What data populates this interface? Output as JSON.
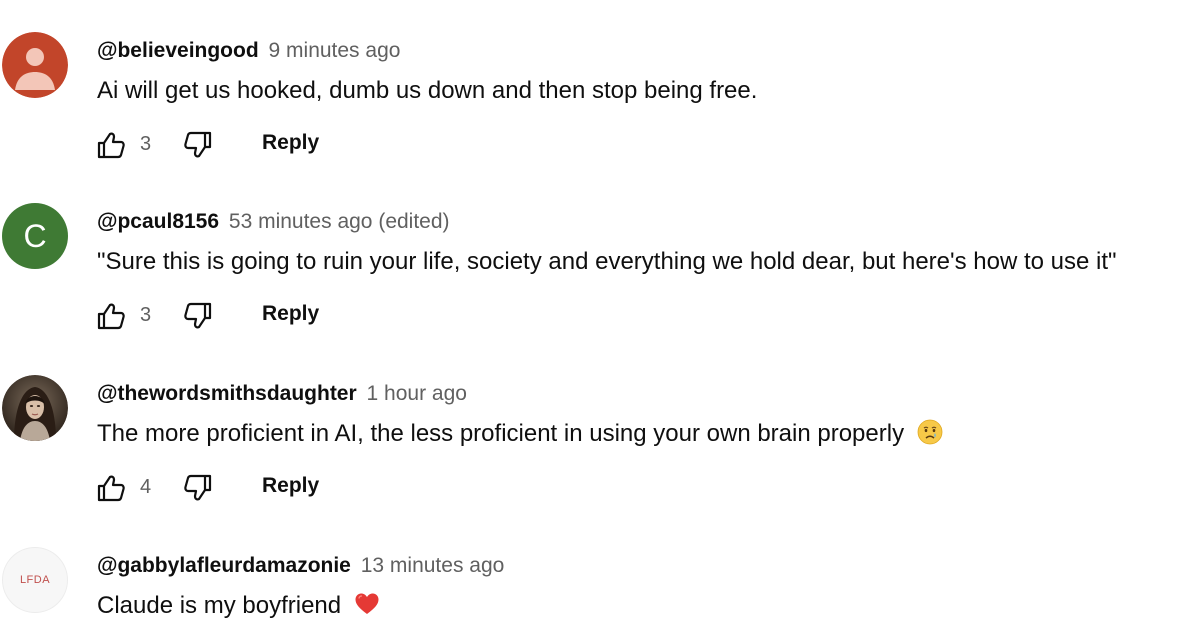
{
  "comments": [
    {
      "author": "@believeingood",
      "time": "9 minutes ago",
      "text": "Ai will get us hooked, dumb us down and then stop being free.",
      "likes": "3",
      "reply_label": "Reply",
      "avatar": {
        "type": "default-person",
        "bg_color": "#c2452a",
        "fg_color": "#f3c6b8"
      }
    },
    {
      "author": "@pcaul8156",
      "time": "53 minutes ago (edited)",
      "text": "\"Sure this is going to ruin your life, society and everything we hold dear, but here's how to use it\"",
      "likes": "3",
      "reply_label": "Reply",
      "avatar": {
        "type": "letter",
        "letter": "C",
        "bg_color": "#3f7a34"
      }
    },
    {
      "author": "@thewordsmithsdaughter",
      "time": "1 hour ago",
      "text": "The more proficient in AI, the less proficient in using your own brain properly",
      "emoji": "crying-face-emoji",
      "likes": "4",
      "reply_label": "Reply",
      "avatar": {
        "type": "photo",
        "bg_color": "#4a3a2e"
      }
    },
    {
      "author": "@gabbylafleurdamazonie",
      "time": "13 minutes ago",
      "text": "Claude is my boyfriend",
      "emoji": "red-heart-emoji",
      "avatar": {
        "type": "logo",
        "logo_text": "LFDA",
        "bg_color": "#f7f7f7",
        "fg_color": "#c0504d"
      }
    }
  ]
}
